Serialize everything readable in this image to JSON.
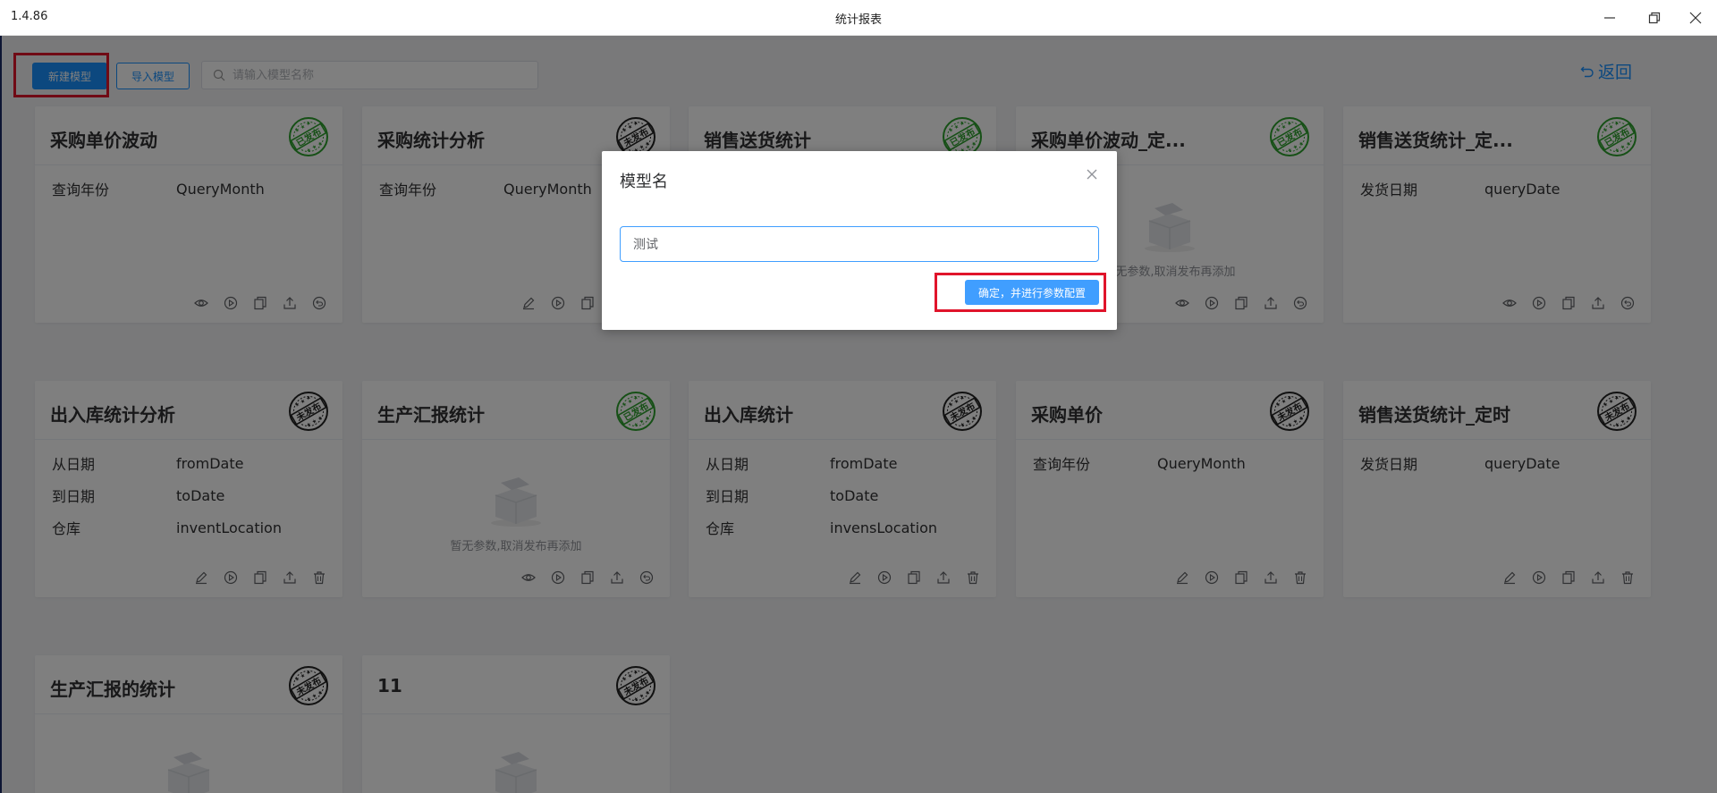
{
  "window": {
    "version": "1.4.86",
    "title": "统计报表"
  },
  "toolbar": {
    "new_model": "新建模型",
    "import_model": "导入模型",
    "search_placeholder": "请输入模型名称",
    "back": "返回"
  },
  "stamps": {
    "published": "已发布",
    "unpublished": "未发布"
  },
  "colors": {
    "primary": "#1890ff",
    "published_stamp": "#2ca02c",
    "unpublished_stamp": "#222222",
    "highlight": "#e0142b"
  },
  "empty_text": "暂无参数,取消发布再添加",
  "cards": [
    {
      "title": "采购单价波动",
      "status": "published",
      "params": [
        [
          "查询年份",
          "QueryMonth"
        ]
      ]
    },
    {
      "title": "采购统计分析",
      "status": "unpublished",
      "params": [
        [
          "查询年份",
          "QueryMonth"
        ]
      ]
    },
    {
      "title": "销售送货统计",
      "status": "published",
      "params": []
    },
    {
      "title": "采购单价波动_定...",
      "status": "published",
      "params": []
    },
    {
      "title": "销售送货统计_定...",
      "status": "published",
      "params": [
        [
          "发货日期",
          "queryDate"
        ]
      ]
    },
    {
      "title": "出入库统计分析",
      "status": "unpublished",
      "params": [
        [
          "从日期",
          "fromDate"
        ],
        [
          "到日期",
          "toDate"
        ],
        [
          "仓库",
          "inventLocation"
        ]
      ]
    },
    {
      "title": "生产汇报统计",
      "status": "published",
      "params": []
    },
    {
      "title": "出入库统计",
      "status": "unpublished",
      "params": [
        [
          "从日期",
          "fromDate"
        ],
        [
          "到日期",
          "toDate"
        ],
        [
          "仓库",
          "invensLocation"
        ]
      ]
    },
    {
      "title": "采购单价",
      "status": "unpublished",
      "params": [
        [
          "查询年份",
          "QueryMonth"
        ]
      ]
    },
    {
      "title": "销售送货统计_定时",
      "status": "unpublished",
      "params": [
        [
          "发货日期",
          "queryDate"
        ]
      ]
    },
    {
      "title": "生产汇报的统计",
      "status": "unpublished",
      "params": []
    },
    {
      "title": "11",
      "status": "unpublished",
      "params": []
    }
  ],
  "dialog": {
    "title": "模型名",
    "input_value": "测试",
    "confirm": "确定，并进行参数配置"
  }
}
